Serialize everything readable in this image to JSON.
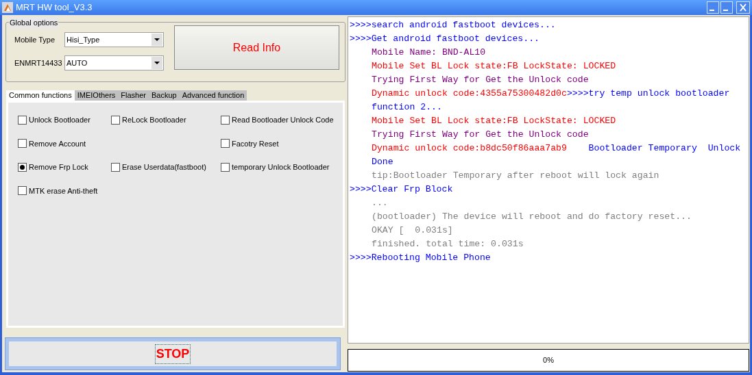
{
  "window": {
    "title": "MRT HW tool_V3.3"
  },
  "global_options": {
    "title": "Global options",
    "fields": [
      {
        "label": "Mobile Type",
        "value": "Hisi_Type"
      },
      {
        "label": "ENMRT14433",
        "value": "AUTO"
      }
    ],
    "read_button": "Read Info"
  },
  "tabs": [
    {
      "label": "Common functions",
      "selected": true
    },
    {
      "label": "IMEIOthers",
      "selected": false
    },
    {
      "label": "Flasher",
      "selected": false
    },
    {
      "label": "Backup",
      "selected": false
    },
    {
      "label": "Advanced function",
      "selected": false
    }
  ],
  "option_rows": [
    {
      "left": {
        "label": "Unlock Bootloader",
        "checked": false
      },
      "middle": {
        "label": "ReLock Bootloader",
        "checked": false
      },
      "right": {
        "label": "Read Bootloader Unlock Code",
        "checked": false
      }
    },
    {
      "left": {
        "label": "Remove Account",
        "checked": false
      },
      "right": {
        "label": "Facotry Reset",
        "checked": false
      }
    },
    {
      "left": {
        "label": "Remove Frp Lock",
        "checked": true
      },
      "middle": {
        "label": "Erase Userdata(fastboot)",
        "checked": false
      },
      "right": {
        "label": "temporary Unlock Bootloader",
        "checked": false
      }
    },
    {
      "left": {
        "label": "MTK erase Anti-theft",
        "checked": false
      }
    }
  ],
  "stop_button": "STOP",
  "log": [
    {
      "indent": false,
      "segments": [
        {
          "kind": "command",
          "text": ">>>>search android fastboot devices..."
        }
      ]
    },
    {
      "indent": false,
      "segments": [
        {
          "kind": "command",
          "text": ">>>>Get android fastboot devices..."
        }
      ]
    },
    {
      "indent": true,
      "segments": [
        {
          "kind": "info",
          "text": "Mobile Name: BND-AL10"
        }
      ]
    },
    {
      "indent": true,
      "segments": [
        {
          "kind": "error",
          "text": "Mobile Set BL Lock state:FB LockState: LOCKED"
        }
      ]
    },
    {
      "indent": true,
      "segments": [
        {
          "kind": "info",
          "text": "Trying First Way for Get the Unlock code"
        }
      ]
    },
    {
      "indent": true,
      "segments": [
        {
          "kind": "error",
          "text": "Dynamic unlock code:4355a75300482d0c"
        },
        {
          "kind": "command",
          "text": ">>>>try temp unlock bootloader function 2..."
        }
      ]
    },
    {
      "indent": true,
      "segments": [
        {
          "kind": "error",
          "text": "Mobile Set BL Lock state:FB LockState: LOCKED"
        }
      ]
    },
    {
      "indent": true,
      "segments": [
        {
          "kind": "info",
          "text": "Trying First Way for Get the Unlock code"
        }
      ]
    },
    {
      "indent": true,
      "segments": [
        {
          "kind": "error",
          "text": "Dynamic unlock code:b8dc50f86aaa7ab9"
        },
        {
          "kind": "command",
          "text": "    Bootloader Temporary  Unlock Done"
        }
      ]
    },
    {
      "indent": true,
      "segments": [
        {
          "kind": "output",
          "text": "tip:Bootloader Temporary after reboot will lock again"
        }
      ]
    },
    {
      "indent": false,
      "segments": [
        {
          "kind": "command",
          "text": ">>>>Clear Frp Block"
        }
      ]
    },
    {
      "indent": true,
      "segments": [
        {
          "kind": "output",
          "text": "..."
        }
      ]
    },
    {
      "indent": true,
      "segments": [
        {
          "kind": "output",
          "text": "(bootloader) The device will reboot and do factory reset..."
        }
      ]
    },
    {
      "indent": true,
      "segments": [
        {
          "kind": "output",
          "text": "OKAY [  0.031s]"
        }
      ]
    },
    {
      "indent": true,
      "segments": [
        {
          "kind": "output",
          "text": "finished. total time: 0.031s"
        }
      ]
    },
    {
      "indent": false,
      "segments": [
        {
          "kind": "command",
          "text": ">>>>Rebooting Mobile Phone"
        }
      ]
    }
  ],
  "progress": {
    "level": 0,
    "text": "0%"
  }
}
